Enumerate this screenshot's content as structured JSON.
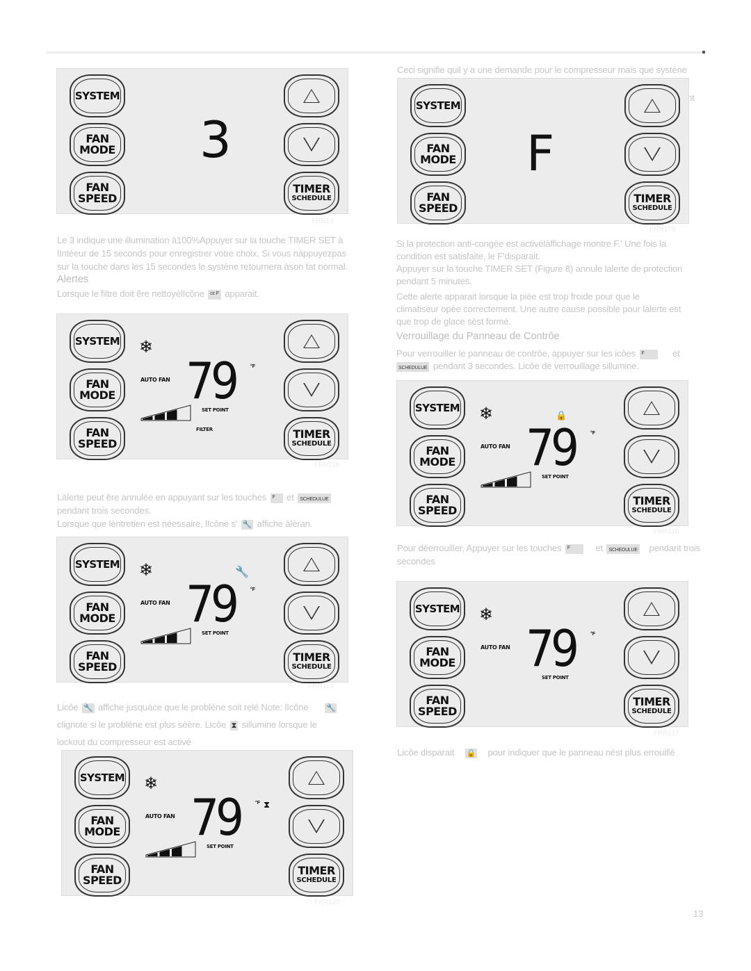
{
  "page_number": "13",
  "panel_buttons": {
    "system": "SYSTEM",
    "fan_mode": [
      "FAN",
      "MODE"
    ],
    "fan_speed": [
      "FAN",
      "SPEED"
    ],
    "timer_schedule": [
      "TIMER",
      "SCHEDULE"
    ],
    "up": "up",
    "down": "down"
  },
  "panel_labels": {
    "auto_fan": "AUTO FAN",
    "set_point": "SET POINT",
    "filter": "FILTER",
    "degree_f": "°F",
    "temperature": "79"
  },
  "figures": {
    "fig_3": {
      "display": "3",
      "label": "FRR19"
    },
    "fig_f": {
      "display": "F",
      "label": "FRR179"
    },
    "fig_filter": {
      "label": "FRR118"
    },
    "fig_wrench": {
      "label": "FRR119"
    },
    "fig_hourglass": {
      "label": "FRR120"
    },
    "fig_locked": {
      "label": "FRR116"
    },
    "fig_unlocked": {
      "label": "FRR117"
    }
  },
  "fan_speed_level": {
    "filled_segments": 3,
    "total_segments": 4
  },
  "left_column": {
    "p1": [
      "Le 3 indique une illumination à100%Appuyer sur la touche TIMER SET à",
      "lIntéeur de 15 seconds pour enregistrer votre choix. Si vous nàppuyezpas",
      "sur la touche dans les 15 secondes le systène retournera àson ẗat normal."
    ],
    "alerts_heading": "Alertes",
    "p2_before": "Lorsque le filtre doit ẽre nettoyélIcône",
    "p2_icon": "cc F",
    "p2_after": "apparait.",
    "p3_a": "Làlerte peut ẽre annulée en appuyant sur les touches",
    "p3_icon1": "F",
    "p3_mid": "et",
    "p3_icon2": "SCHEDULUE",
    "p3_b": "pendant trois secondes.",
    "p4_before": "Lorsque que lèntretien est néessaire, lIcône s'",
    "p4_after": "affiche àlèran.",
    "p5_a1": "Licôe",
    "p5_a2": "affiche jusquàce que le problène soit rẹlé Note: lIcône",
    "p5_b1": "clignote si le problène est plus séère. Licôe",
    "p5_b2": "sillumine lorsque le",
    "p5_c": "lockout du compresseur est activé"
  },
  "right_column": {
    "p0": "Ceci signifie quil y a une demande pour le compresseur mais que systène",
    "p0_tail": "nt",
    "p1": [
      "Si la protection anti-congèe est activélàffichage montre F.' Une fois la",
      "condition est satisfaite, le F'disparait.",
      "Appuyer sur la touche TIMER SET (Figure 8) annule lalerte de protection",
      "pendant 5 minutes."
    ],
    "p2": [
      "Cette alerte apparait lorsque la pièe est trop froide pour que le",
      "climatiseur opèe correctement. Une autre cause possible pour làlerte est",
      "que trop de glace sèst formé."
    ],
    "lock_heading": "Verrouillage du Panneau de Contrôe",
    "p3_a": "Pour verrouiller le panneau de contrôe, appuyer sur les icôes",
    "p3_icon1": "F",
    "p3_et": "et",
    "p3_icon2": "SCHEDULUE",
    "p3_b": "pendant 3 secondes. Licôe de verrouillage sillumine.",
    "p4_a": "Pour déerrouiller, Appuyer sur les touches",
    "p4_icon1": "F",
    "p4_et": "et",
    "p4_icon2": "SCHEDULUE",
    "p4_b": "pendant trois",
    "p4_c": "secondes",
    "p5_a": "Licôe disparait",
    "p5_b": "pour indiquer que le panneau nèst plus errouillé"
  }
}
